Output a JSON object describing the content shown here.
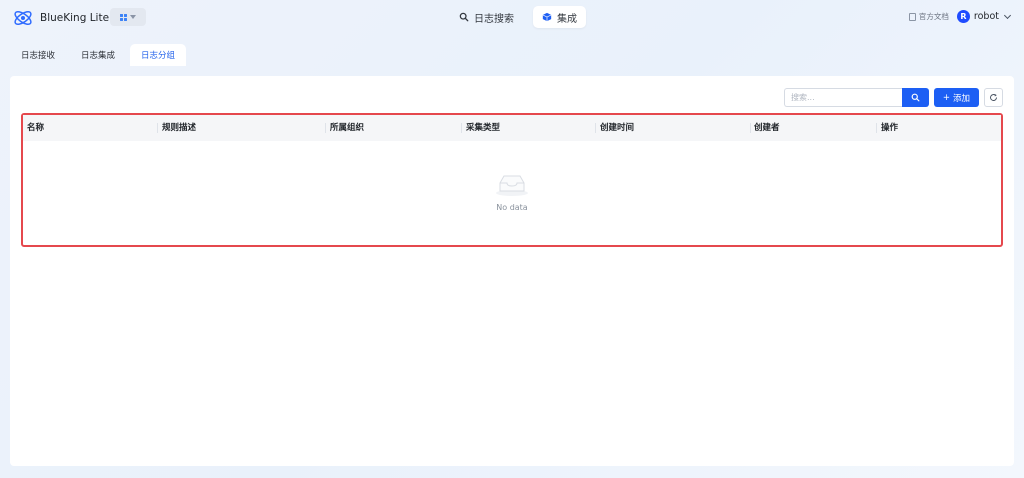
{
  "brand": {
    "name": "BlueKing Lite"
  },
  "nav": {
    "items": [
      {
        "label": "日志搜索",
        "icon": "search-icon",
        "active": false
      },
      {
        "label": "集成",
        "icon": "cube-icon",
        "active": true
      }
    ]
  },
  "header_right": {
    "doc_label": "官方文档",
    "user_name": "robot",
    "user_initial": "R"
  },
  "tabs": [
    {
      "label": "日志接收",
      "active": false
    },
    {
      "label": "日志集成",
      "active": false
    },
    {
      "label": "日志分组",
      "active": true
    }
  ],
  "toolbar": {
    "search_placeholder": "搜索...",
    "add_label": "添加",
    "add_prefix": "+"
  },
  "table": {
    "columns": [
      "名称",
      "规则描述",
      "所属组织",
      "采集类型",
      "创建时间",
      "创建者",
      "操作"
    ],
    "empty_text": "No data"
  },
  "colors": {
    "accent": "#1d5ff4",
    "highlight_border": "#e5484d"
  }
}
